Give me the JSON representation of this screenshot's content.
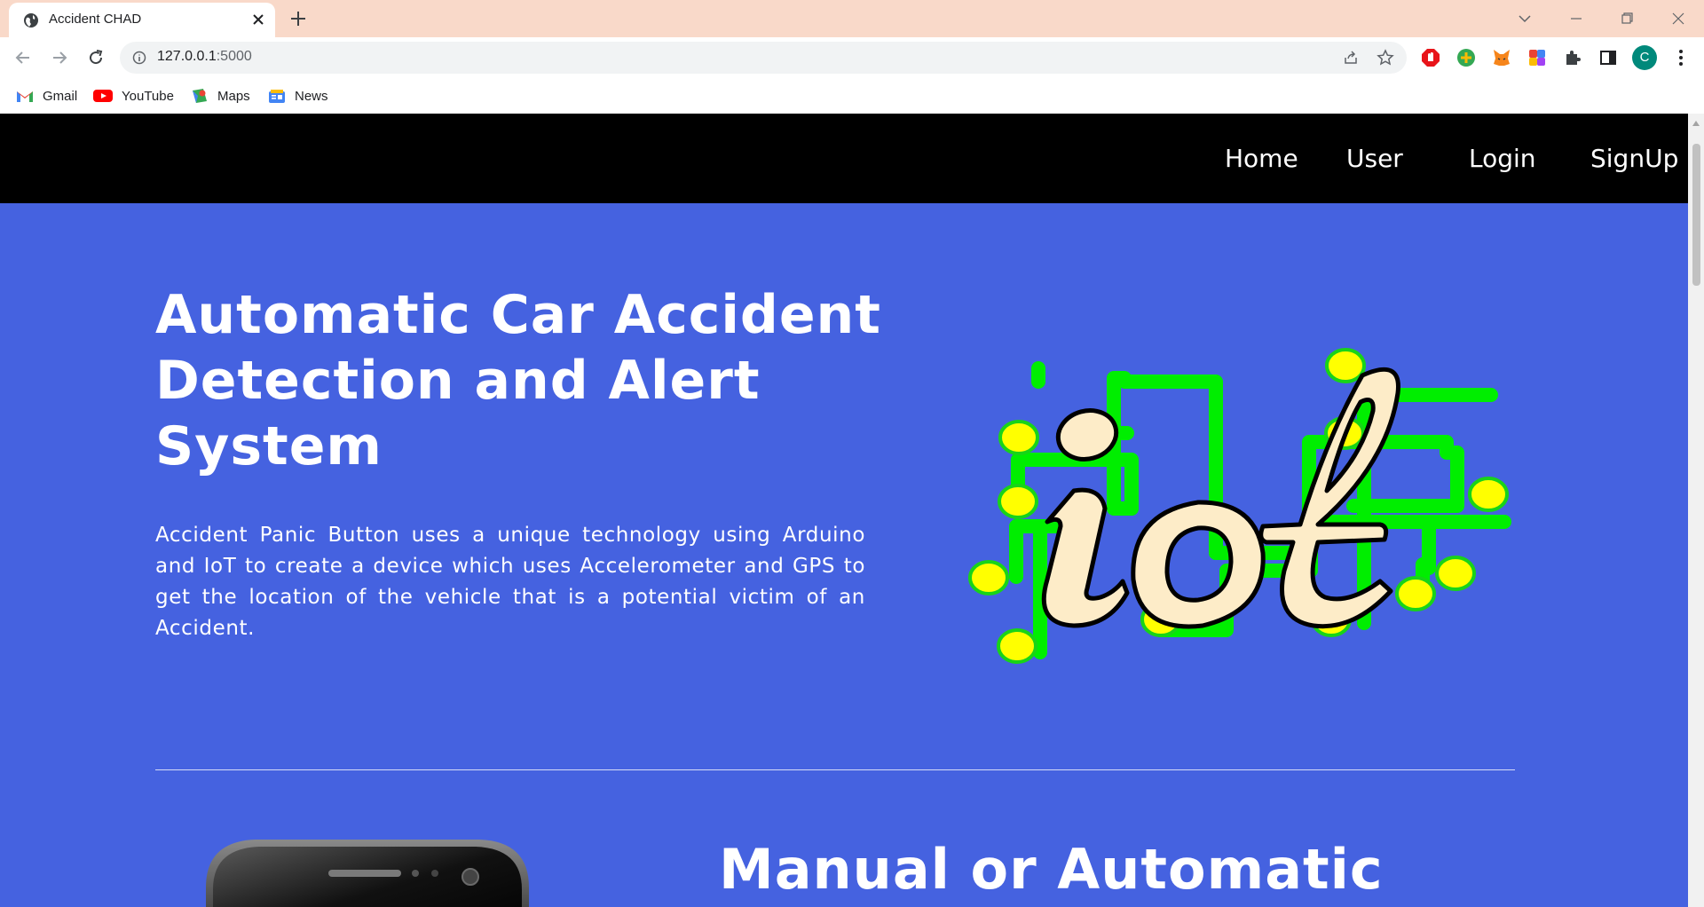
{
  "browser": {
    "tab_title": "Accident CHAD",
    "url_host": "127.0.0.1",
    "url_port": ":5000",
    "profile_initial": "C",
    "bookmarks": [
      {
        "label": "Gmail",
        "icon": "gmail-icon"
      },
      {
        "label": "YouTube",
        "icon": "youtube-icon"
      },
      {
        "label": "Maps",
        "icon": "maps-icon"
      },
      {
        "label": "News",
        "icon": "news-icon"
      }
    ],
    "extensions": [
      "adblock-icon",
      "green-plus-extension-icon",
      "metamask-icon",
      "colorful-extension-icon",
      "puzzle-icon",
      "sidepanel-icon"
    ]
  },
  "site": {
    "nav": [
      "Home",
      "User",
      "Login",
      "SignUp"
    ],
    "hero": {
      "title": "Automatic Car Accident Detection and Alert System",
      "text": "Accident Panic Button uses a unique technology using Arduino and IoT to create a device which uses Accelerometer and GPS to get the location of the vehicle that is a potential victim of an Accident.",
      "logo_text": "iot"
    },
    "section2": {
      "title": "Manual or Automatic"
    }
  },
  "colors": {
    "page_background": "#4562e0",
    "nav_background": "#000000",
    "tabstrip": "#f9d9c9",
    "circuit_green": "#00ee00",
    "node_yellow": "#ffff00",
    "logo_fill": "#fdecc8"
  }
}
